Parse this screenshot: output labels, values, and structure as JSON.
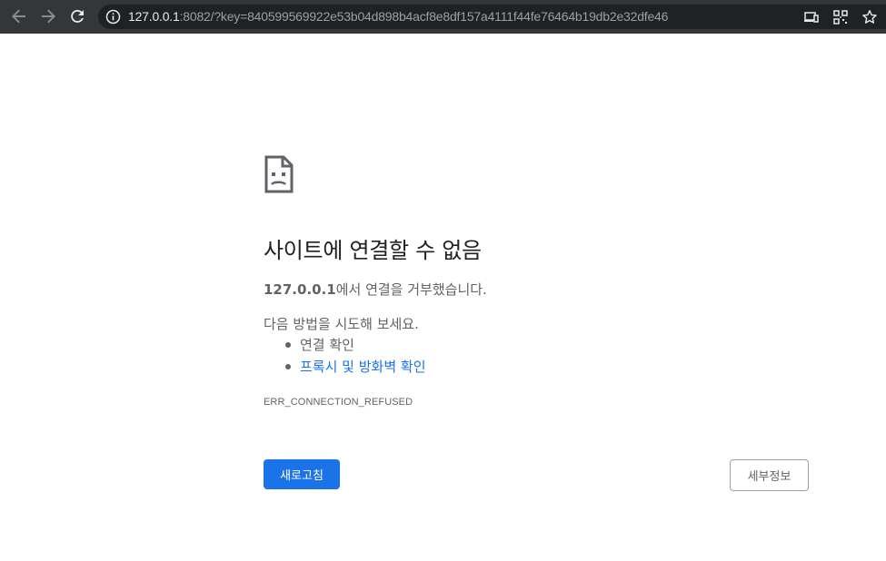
{
  "browser": {
    "url_host": "127.0.0.1",
    "url_rest": ":8082/?key=840599569922e53b04d898b4acf8e8df157a4111f44fe76464b19db2e32dfe46",
    "icons": {
      "back": "arrow-left-icon",
      "forward": "arrow-right-icon",
      "reload": "reload-icon",
      "info": "info-icon",
      "cast": "cast-icon",
      "qr": "qr-code-icon",
      "bookmark": "star-icon"
    },
    "colors": {
      "toolbar": "#35363a",
      "omnibox": "#202124"
    }
  },
  "error": {
    "icon": "sad-page-icon",
    "heading": "사이트에 연결할 수 없음",
    "host_bold": "127.0.0.1",
    "message": "에서 연결을 거부했습니다.",
    "try_label": "다음 방법을 시도해 보세요.",
    "suggestions": [
      {
        "label": "연결 확인"
      },
      {
        "label": "프록시 및 방화벽 확인"
      }
    ],
    "code": "ERR_CONNECTION_REFUSED",
    "reload_label": "새로고침",
    "details_label": "세부정보",
    "colors": {
      "primary": "#1a73e8",
      "text": "#5f6368"
    }
  }
}
